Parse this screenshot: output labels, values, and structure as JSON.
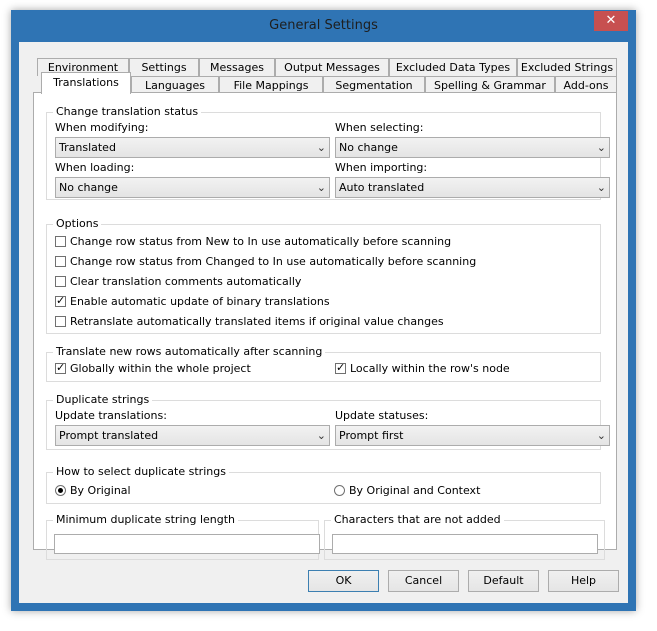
{
  "window": {
    "title": "General Settings",
    "close_glyph": "✕"
  },
  "tabs_row1": [
    "Environment",
    "Settings",
    "Messages",
    "Output Messages",
    "Excluded Data Types",
    "Excluded Strings"
  ],
  "tabs_row2": [
    "Translations",
    "Languages",
    "File Mappings",
    "Segmentation",
    "Spelling & Grammar",
    "Add-ons"
  ],
  "active_tab": "Translations",
  "change_status": {
    "title": "Change translation status",
    "modifying_label": "When modifying:",
    "modifying_value": "Translated",
    "selecting_label": "When selecting:",
    "selecting_value": "No change",
    "loading_label": "When loading:",
    "loading_value": "No change",
    "importing_label": "When importing:",
    "importing_value": "Auto translated"
  },
  "options": {
    "title": "Options",
    "items": [
      {
        "label": "Change row status from New to In use automatically before scanning",
        "checked": false
      },
      {
        "label": "Change row status from Changed to In use automatically before scanning",
        "checked": false
      },
      {
        "label": "Clear translation comments automatically",
        "checked": false
      },
      {
        "label": "Enable automatic update of binary translations",
        "checked": true
      },
      {
        "label": "Retranslate automatically translated items if original value changes",
        "checked": false
      }
    ]
  },
  "translate_new": {
    "title": "Translate new rows automatically after scanning",
    "globally_label": "Globally within the whole project",
    "globally_checked": true,
    "locally_label": "Locally within the row's node",
    "locally_checked": true
  },
  "duplicates": {
    "title": "Duplicate strings",
    "update_translations_label": "Update translations:",
    "update_translations_value": "Prompt translated",
    "update_statuses_label": "Update statuses:",
    "update_statuses_value": "Prompt first"
  },
  "select_duplicates": {
    "title": "How to select duplicate strings",
    "by_original": "By Original",
    "by_original_context": "By Original and Context",
    "selected": "By Original"
  },
  "min_length": {
    "title": "Minimum duplicate string length",
    "value": ""
  },
  "not_added": {
    "title": "Characters that are not added",
    "value": ""
  },
  "buttons": {
    "ok": "OK",
    "cancel": "Cancel",
    "default": "Default",
    "help": "Help"
  },
  "glyphs": {
    "dropdown": "⌄"
  }
}
